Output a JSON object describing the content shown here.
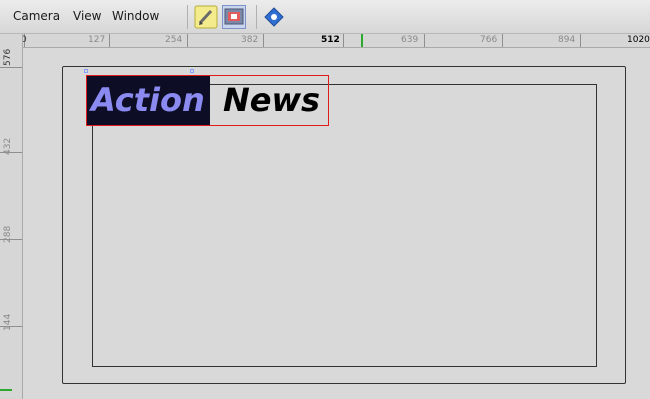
{
  "menubar": {
    "items": [
      "Camera",
      "View",
      "Window"
    ]
  },
  "toolbar": {
    "buttons": [
      {
        "name": "pencil-tool-icon"
      },
      {
        "name": "camera-preview-icon"
      },
      {
        "name": "navigator-diamond-icon"
      }
    ]
  },
  "ruler": {
    "horizontal": [
      "0",
      "127",
      "254",
      "382",
      "512",
      "639",
      "766",
      "894",
      "1020"
    ],
    "vertical": [
      "576",
      "432",
      "288",
      "144"
    ],
    "highlight_value": "512"
  },
  "canvas": {
    "title_words": [
      "Action",
      "News"
    ],
    "colors": {
      "background": "#d9d9d9",
      "title_box_bg": "#0d0d26",
      "word1": "#8a8af0",
      "word2": "#000000",
      "selection": "#e01b1b"
    }
  }
}
